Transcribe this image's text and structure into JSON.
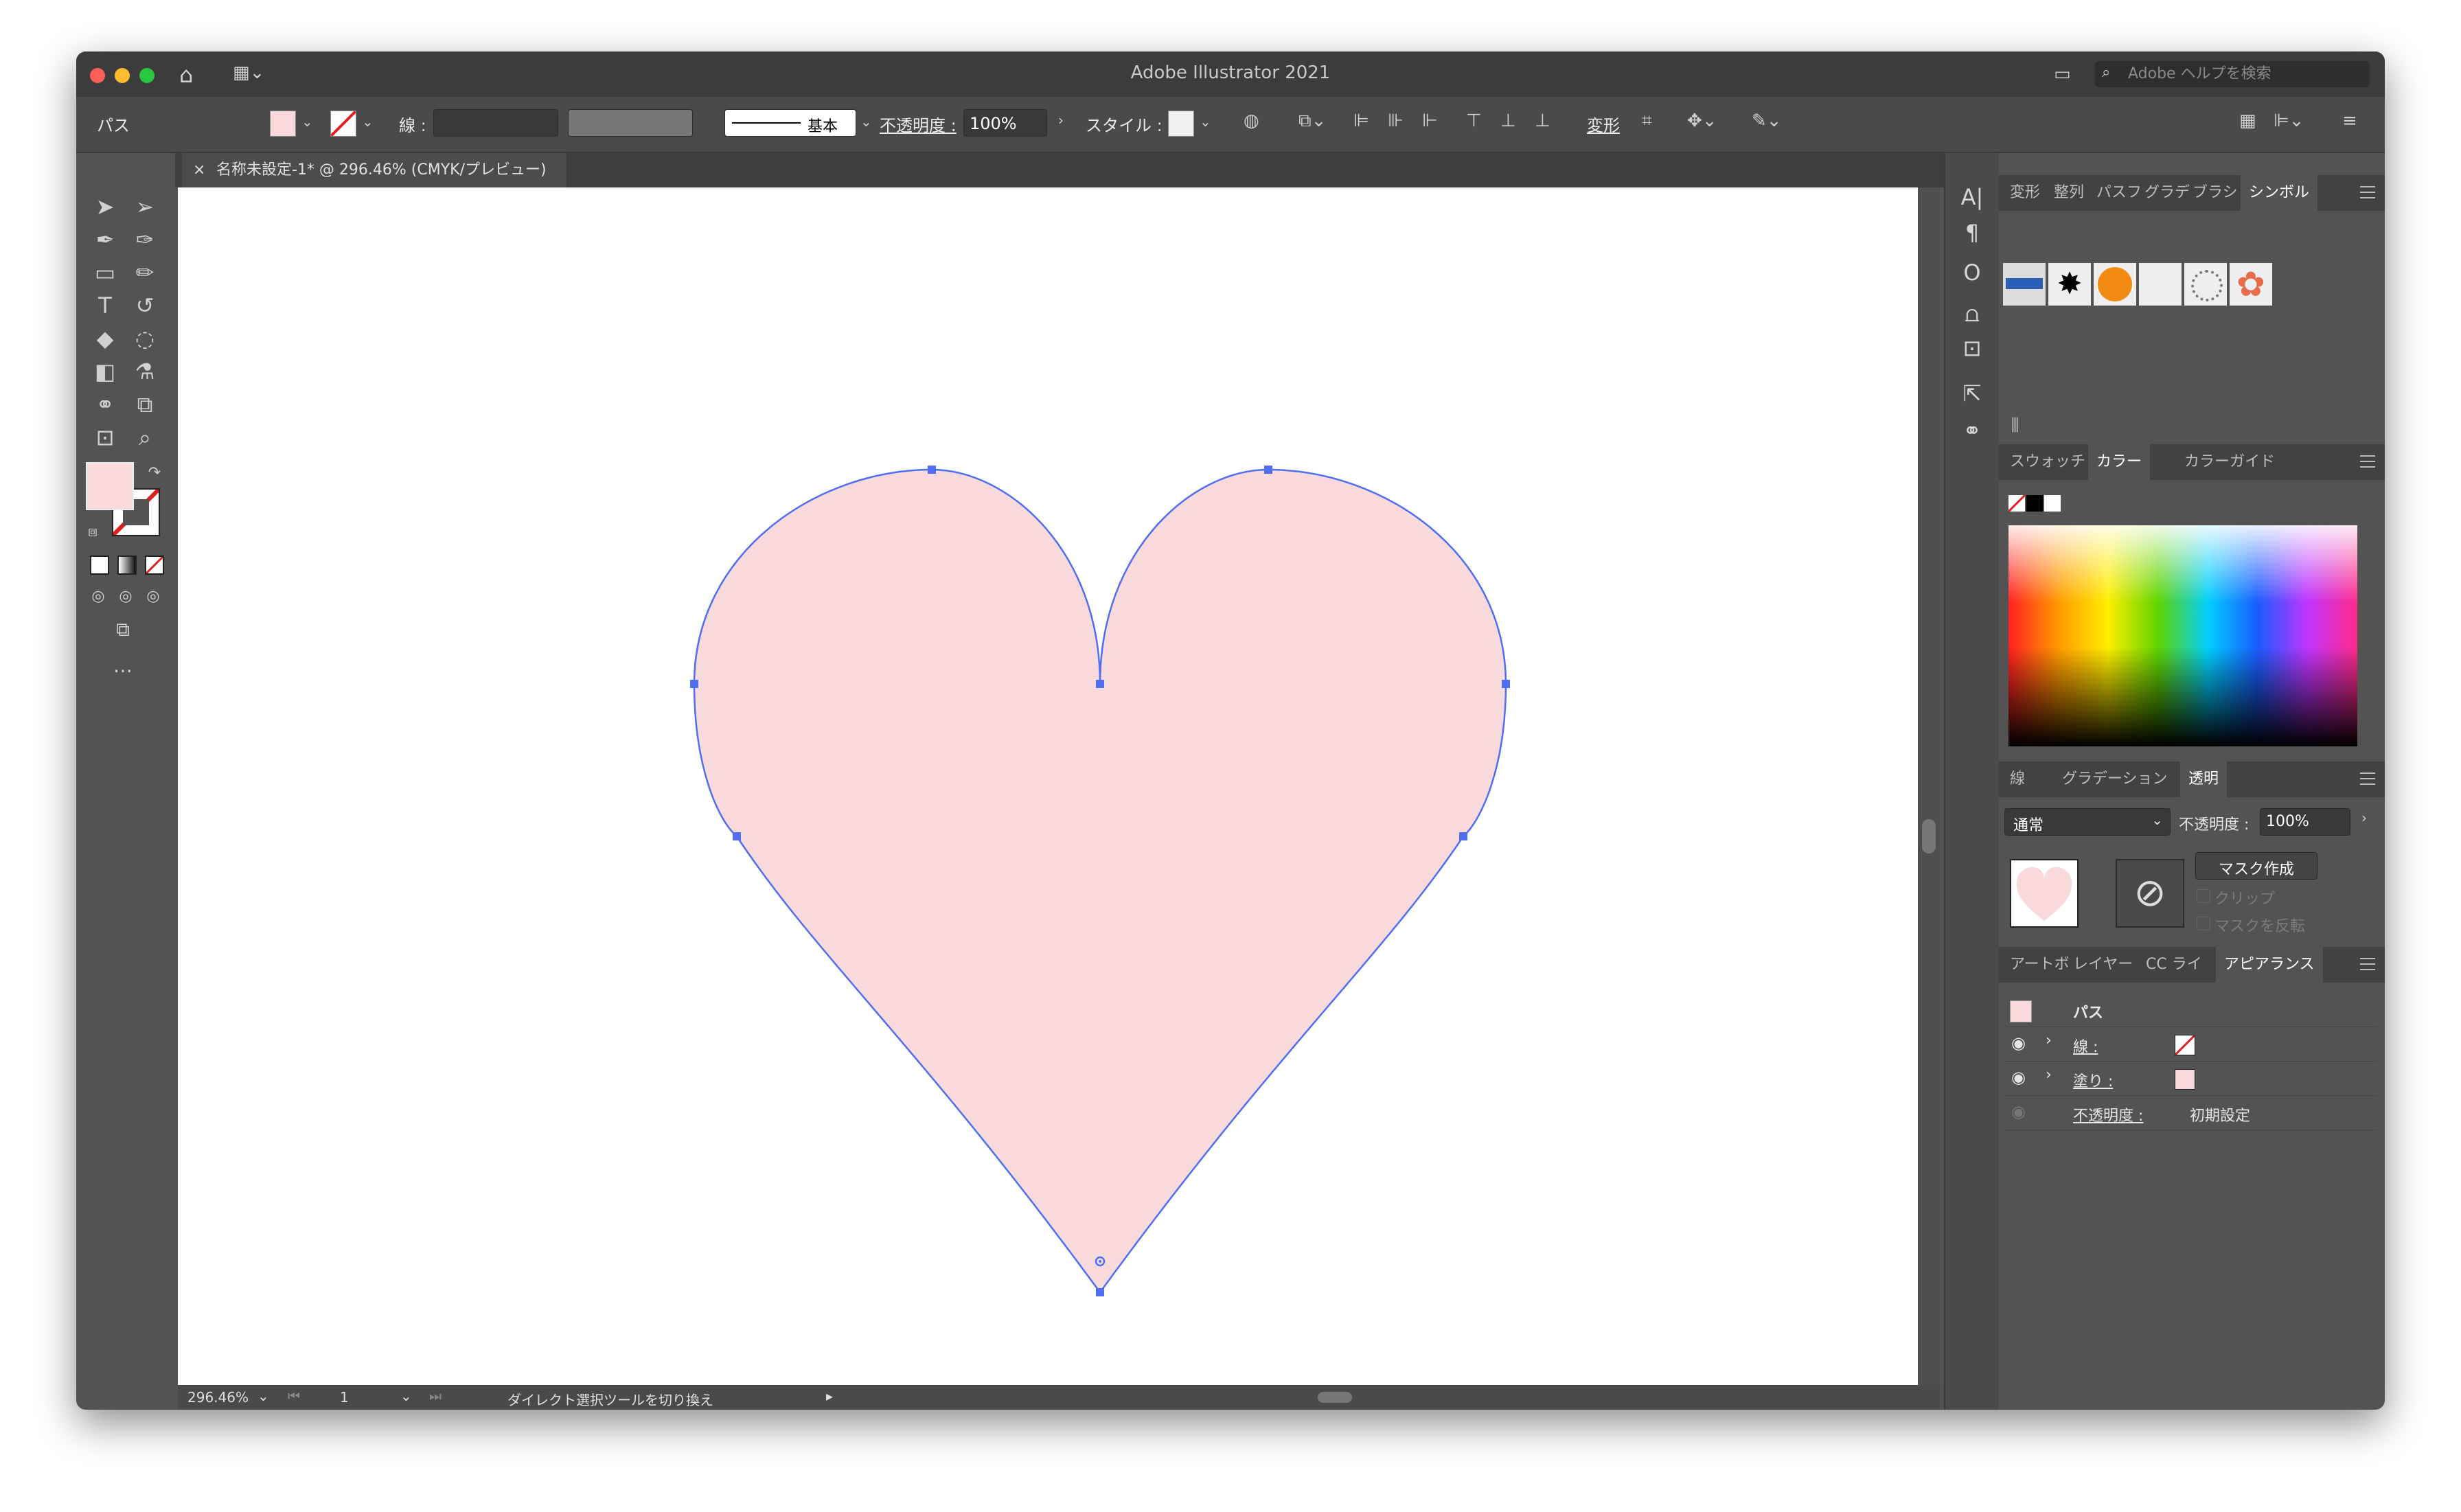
{
  "window": {
    "title": "Adobe Illustrator 2021"
  },
  "help_search": {
    "placeholder": "Adobe ヘルプを検索"
  },
  "control_bar": {
    "object_type": "パス",
    "stroke_label": "線 :",
    "brush_label": "基本",
    "opacity_label": "不透明度 :",
    "opacity_value": "100%",
    "style_label": "スタイル :",
    "transform_label": "変形",
    "fill_color": "#f8dadc"
  },
  "document": {
    "tab_title": "名称未設定-1* @ 296.46% (CMYK/プレビュー)",
    "fill_color": "#f8dadc",
    "path_color": "#4f6ef2"
  },
  "status_bar": {
    "zoom": "296.46%",
    "artboard": "1",
    "message": "ダイレクト選択ツールを切り換え"
  },
  "panels": {
    "top_tabs": [
      "変形",
      "整列",
      "パスフ",
      "グラデ",
      "ブラシ",
      "シンボル"
    ],
    "top_active": "シンボル",
    "color_tabs": [
      "スウォッチ",
      "カラー",
      "カラーガイド"
    ],
    "color_active": "カラー",
    "transparency_tabs": [
      "線",
      "グラデーション",
      "透明"
    ],
    "transparency_active": "透明",
    "blend_mode": "通常",
    "opacity_label": "不透明度 :",
    "opacity_value": "100%",
    "make_mask": "マスク作成",
    "clip": "クリップ",
    "invert_mask": "マスクを反転",
    "appearance_tabs": [
      "アートボ",
      "レイヤー",
      "CC ライ",
      "アピアランス"
    ],
    "appearance_active": "アピアランス",
    "appearance_title": "パス",
    "stroke_row": "線 :",
    "fill_row": "塗り :",
    "opacity_row": "不透明度 :",
    "opacity_row_value": "初期設定"
  }
}
